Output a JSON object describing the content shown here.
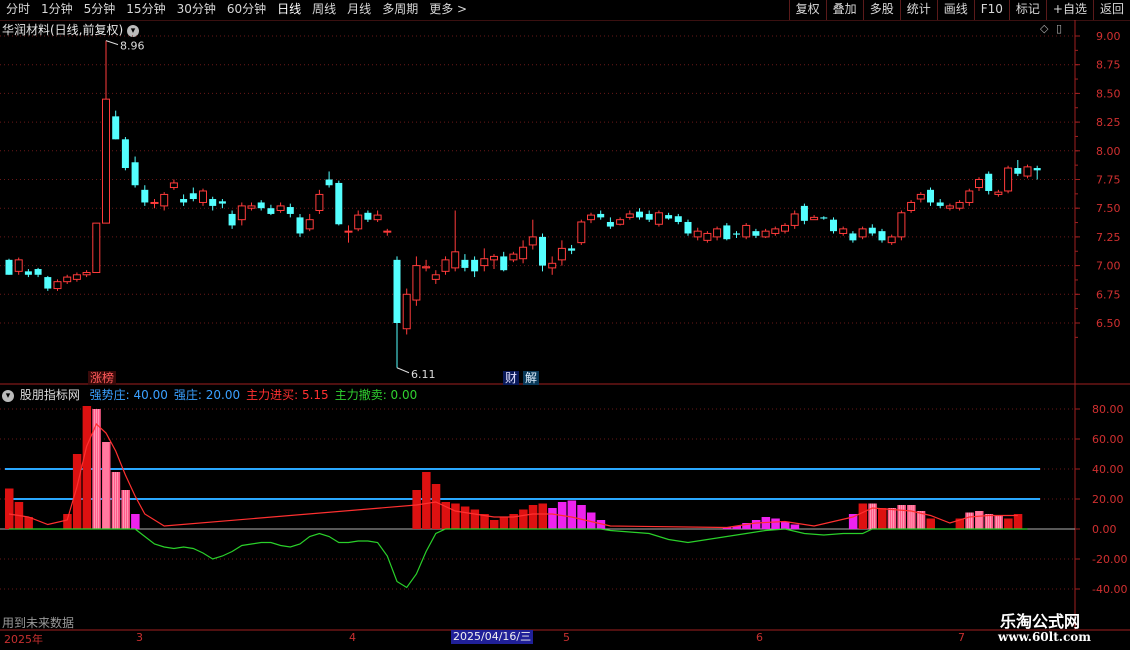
{
  "toolbar": {
    "tabs": [
      "分时",
      "1分钟",
      "5分钟",
      "15分钟",
      "30分钟",
      "60分钟",
      "日线",
      "周线",
      "月线",
      "多周期",
      "更多 >"
    ],
    "active_tab": "日线",
    "right_buttons": [
      "复权",
      "叠加",
      "多股",
      "统计",
      "画线",
      "F10",
      "标记",
      "+自选",
      "返回"
    ]
  },
  "price_panel": {
    "title": "华润材料(日线,前复权)",
    "y_ticks": [
      "9.00",
      "8.75",
      "8.50",
      "8.25",
      "8.00",
      "7.75",
      "7.50",
      "7.25",
      "7.00",
      "6.75",
      "6.50"
    ],
    "high_marker": "8.96",
    "low_marker": "6.11",
    "badges": {
      "limit_up": "涨榜",
      "finance1": "财",
      "finance2": "解"
    }
  },
  "indicator": {
    "name": "股朋指标网",
    "items": [
      {
        "label": "强势庄: 40.00",
        "color": "#3aa0ff"
      },
      {
        "label": "强庄: 20.00",
        "color": "#3aa0ff"
      },
      {
        "label": "主力进买: 5.15",
        "color": "#ff3030"
      },
      {
        "label": "主力撤卖: 0.00",
        "color": "#30d030"
      }
    ],
    "y_ticks": [
      "80.00",
      "60.00",
      "40.00",
      "20.00",
      "0.00",
      "-20.00",
      "-40.00"
    ],
    "level_lines": [
      40,
      20
    ]
  },
  "footer": {
    "future_data": "用到未来数据",
    "axis_labels": [
      "2025年",
      "3",
      "4",
      "2025/04/16/三",
      "5",
      "6",
      "7"
    ],
    "watermark_1": "乐淘公式网",
    "watermark_2": "www.60lt.com"
  },
  "chart_data": {
    "type": "candlestick",
    "price_range": [
      6.0,
      9.1
    ],
    "candles": [
      [
        7.05,
        6.92,
        7.06,
        6.92
      ],
      [
        6.95,
        7.05,
        7.07,
        6.92
      ],
      [
        6.95,
        6.92,
        6.97,
        6.9
      ],
      [
        6.97,
        6.92,
        6.98,
        6.9
      ],
      [
        6.9,
        6.8,
        6.91,
        6.78
      ],
      [
        6.8,
        6.86,
        6.88,
        6.78
      ],
      [
        6.86,
        6.9,
        6.92,
        6.84
      ],
      [
        6.88,
        6.92,
        6.94,
        6.86
      ],
      [
        6.92,
        6.94,
        6.96,
        6.9
      ],
      [
        6.94,
        7.37,
        7.37,
        6.94
      ],
      [
        7.37,
        8.45,
        8.96,
        7.37
      ],
      [
        8.3,
        8.1,
        8.35,
        8.1
      ],
      [
        8.1,
        7.85,
        8.12,
        7.83
      ],
      [
        7.9,
        7.7,
        7.95,
        7.68
      ],
      [
        7.66,
        7.55,
        7.7,
        7.52
      ],
      [
        7.55,
        7.55,
        7.58,
        7.5
      ],
      [
        7.52,
        7.62,
        7.64,
        7.48
      ],
      [
        7.68,
        7.72,
        7.75,
        7.66
      ],
      [
        7.58,
        7.55,
        7.62,
        7.52
      ],
      [
        7.63,
        7.58,
        7.68,
        7.56
      ],
      [
        7.55,
        7.65,
        7.67,
        7.52
      ],
      [
        7.58,
        7.52,
        7.6,
        7.48
      ],
      [
        7.56,
        7.54,
        7.58,
        7.5
      ],
      [
        7.45,
        7.35,
        7.48,
        7.32
      ],
      [
        7.4,
        7.52,
        7.55,
        7.35
      ],
      [
        7.5,
        7.52,
        7.55,
        7.48
      ],
      [
        7.55,
        7.5,
        7.57,
        7.48
      ],
      [
        7.5,
        7.45,
        7.53,
        7.44
      ],
      [
        7.48,
        7.52,
        7.55,
        7.46
      ],
      [
        7.51,
        7.45,
        7.54,
        7.42
      ],
      [
        7.42,
        7.28,
        7.45,
        7.25
      ],
      [
        7.32,
        7.4,
        7.45,
        7.3
      ],
      [
        7.48,
        7.62,
        7.66,
        7.45
      ],
      [
        7.75,
        7.7,
        7.82,
        7.68
      ],
      [
        7.72,
        7.36,
        7.74,
        7.35
      ],
      [
        7.3,
        7.3,
        7.35,
        7.2
      ],
      [
        7.32,
        7.44,
        7.48,
        7.3
      ],
      [
        7.46,
        7.4,
        7.48,
        7.38
      ],
      [
        7.4,
        7.44,
        7.48,
        7.38
      ],
      [
        7.3,
        7.3,
        7.32,
        7.26
      ],
      [
        7.05,
        6.5,
        7.08,
        6.11
      ],
      [
        6.45,
        6.75,
        6.8,
        6.4
      ],
      [
        6.7,
        7.0,
        7.08,
        6.65
      ],
      [
        6.98,
        6.99,
        7.05,
        6.95
      ],
      [
        6.88,
        6.92,
        6.96,
        6.84
      ],
      [
        6.95,
        7.05,
        7.08,
        6.92
      ],
      [
        6.98,
        7.12,
        7.48,
        6.95
      ],
      [
        7.05,
        6.98,
        7.1,
        6.95
      ],
      [
        7.05,
        6.95,
        7.08,
        6.9
      ],
      [
        7.0,
        7.06,
        7.15,
        6.95
      ],
      [
        7.05,
        7.08,
        7.1,
        6.97
      ],
      [
        7.08,
        6.96,
        7.12,
        6.95
      ],
      [
        7.05,
        7.1,
        7.12,
        7.03
      ],
      [
        7.06,
        7.16,
        7.22,
        7.02
      ],
      [
        7.18,
        7.25,
        7.4,
        7.14
      ],
      [
        7.25,
        7.0,
        7.28,
        6.95
      ],
      [
        6.98,
        7.02,
        7.08,
        6.92
      ],
      [
        7.05,
        7.15,
        7.22,
        7.0
      ],
      [
        7.15,
        7.13,
        7.18,
        7.1
      ],
      [
        7.2,
        7.38,
        7.4,
        7.18
      ],
      [
        7.4,
        7.44,
        7.46,
        7.37
      ],
      [
        7.45,
        7.42,
        7.48,
        7.4
      ],
      [
        7.38,
        7.34,
        7.42,
        7.32
      ],
      [
        7.36,
        7.4,
        7.42,
        7.35
      ],
      [
        7.42,
        7.45,
        7.48,
        7.4
      ],
      [
        7.47,
        7.42,
        7.5,
        7.4
      ],
      [
        7.45,
        7.4,
        7.48,
        7.38
      ],
      [
        7.36,
        7.46,
        7.48,
        7.34
      ],
      [
        7.44,
        7.41,
        7.46,
        7.4
      ],
      [
        7.43,
        7.38,
        7.45,
        7.36
      ],
      [
        7.38,
        7.28,
        7.4,
        7.26
      ],
      [
        7.25,
        7.3,
        7.33,
        7.22
      ],
      [
        7.22,
        7.28,
        7.3,
        7.2
      ],
      [
        7.25,
        7.32,
        7.34,
        7.22
      ],
      [
        7.35,
        7.23,
        7.37,
        7.22
      ],
      [
        7.28,
        7.27,
        7.3,
        7.24
      ],
      [
        7.25,
        7.35,
        7.37,
        7.23
      ],
      [
        7.3,
        7.26,
        7.32,
        7.24
      ],
      [
        7.25,
        7.3,
        7.32,
        7.24
      ],
      [
        7.28,
        7.32,
        7.34,
        7.26
      ],
      [
        7.3,
        7.35,
        7.37,
        7.28
      ],
      [
        7.35,
        7.45,
        7.48,
        7.32
      ],
      [
        7.52,
        7.39,
        7.54,
        7.36
      ],
      [
        7.4,
        7.42,
        7.44,
        7.4
      ],
      [
        7.42,
        7.41,
        7.43,
        7.4
      ],
      [
        7.4,
        7.3,
        7.42,
        7.28
      ],
      [
        7.28,
        7.32,
        7.34,
        7.26
      ],
      [
        7.28,
        7.22,
        7.3,
        7.2
      ],
      [
        7.25,
        7.32,
        7.34,
        7.23
      ],
      [
        7.33,
        7.28,
        7.36,
        7.26
      ],
      [
        7.3,
        7.22,
        7.32,
        7.2
      ],
      [
        7.2,
        7.25,
        7.27,
        7.18
      ],
      [
        7.25,
        7.46,
        7.48,
        7.22
      ],
      [
        7.48,
        7.55,
        7.57,
        7.46
      ],
      [
        7.58,
        7.62,
        7.64,
        7.55
      ],
      [
        7.66,
        7.55,
        7.68,
        7.52
      ],
      [
        7.55,
        7.52,
        7.58,
        7.5
      ],
      [
        7.5,
        7.52,
        7.54,
        7.48
      ],
      [
        7.5,
        7.55,
        7.57,
        7.48
      ],
      [
        7.55,
        7.65,
        7.67,
        7.52
      ],
      [
        7.68,
        7.75,
        7.77,
        7.65
      ],
      [
        7.8,
        7.65,
        7.82,
        7.62
      ],
      [
        7.62,
        7.64,
        7.66,
        7.6
      ],
      [
        7.65,
        7.85,
        7.87,
        7.63
      ],
      [
        7.85,
        7.8,
        7.92,
        7.78
      ],
      [
        7.78,
        7.86,
        7.88,
        7.76
      ],
      [
        7.85,
        7.83,
        7.87,
        7.75
      ]
    ],
    "indicator_bars": [
      {
        "i": 0,
        "v": 27,
        "c": "red"
      },
      {
        "i": 1,
        "v": 18,
        "c": "red"
      },
      {
        "i": 2,
        "v": 8,
        "c": "red"
      },
      {
        "i": 6,
        "v": 10,
        "c": "red"
      },
      {
        "i": 7,
        "v": 50,
        "c": "red"
      },
      {
        "i": 8,
        "v": 82,
        "c": "red"
      },
      {
        "i": 9,
        "v": 80,
        "c": "pink"
      },
      {
        "i": 10,
        "v": 58,
        "c": "pink"
      },
      {
        "i": 11,
        "v": 38,
        "c": "pink"
      },
      {
        "i": 12,
        "v": 26,
        "c": "pink"
      },
      {
        "i": 13,
        "v": 10,
        "c": "magenta"
      },
      {
        "i": 42,
        "v": 26,
        "c": "red"
      },
      {
        "i": 43,
        "v": 38,
        "c": "red"
      },
      {
        "i": 44,
        "v": 30,
        "c": "red"
      },
      {
        "i": 45,
        "v": 18,
        "c": "red"
      },
      {
        "i": 46,
        "v": 17,
        "c": "red"
      },
      {
        "i": 47,
        "v": 15,
        "c": "red"
      },
      {
        "i": 48,
        "v": 13,
        "c": "red"
      },
      {
        "i": 49,
        "v": 10,
        "c": "red"
      },
      {
        "i": 50,
        "v": 6,
        "c": "red"
      },
      {
        "i": 51,
        "v": 8,
        "c": "red"
      },
      {
        "i": 52,
        "v": 10,
        "c": "red"
      },
      {
        "i": 53,
        "v": 13,
        "c": "red"
      },
      {
        "i": 54,
        "v": 16,
        "c": "red"
      },
      {
        "i": 55,
        "v": 17,
        "c": "red"
      },
      {
        "i": 56,
        "v": 14,
        "c": "magenta"
      },
      {
        "i": 57,
        "v": 18,
        "c": "magenta"
      },
      {
        "i": 58,
        "v": 19,
        "c": "magenta"
      },
      {
        "i": 59,
        "v": 16,
        "c": "magenta"
      },
      {
        "i": 60,
        "v": 11,
        "c": "magenta"
      },
      {
        "i": 61,
        "v": 6,
        "c": "magenta"
      },
      {
        "i": 74,
        "v": 1,
        "c": "magenta"
      },
      {
        "i": 75,
        "v": 2,
        "c": "magenta"
      },
      {
        "i": 76,
        "v": 4,
        "c": "magenta"
      },
      {
        "i": 77,
        "v": 6,
        "c": "magenta"
      },
      {
        "i": 78,
        "v": 8,
        "c": "magenta"
      },
      {
        "i": 79,
        "v": 7,
        "c": "magenta"
      },
      {
        "i": 80,
        "v": 5,
        "c": "magenta"
      },
      {
        "i": 81,
        "v": 3,
        "c": "magenta"
      },
      {
        "i": 87,
        "v": 10,
        "c": "magenta"
      },
      {
        "i": 88,
        "v": 17,
        "c": "red"
      },
      {
        "i": 89,
        "v": 17,
        "c": "pink"
      },
      {
        "i": 90,
        "v": 14,
        "c": "red"
      },
      {
        "i": 91,
        "v": 14,
        "c": "pink"
      },
      {
        "i": 92,
        "v": 16,
        "c": "pink"
      },
      {
        "i": 93,
        "v": 16,
        "c": "pink"
      },
      {
        "i": 94,
        "v": 12,
        "c": "pink"
      },
      {
        "i": 95,
        "v": 7,
        "c": "red"
      },
      {
        "i": 98,
        "v": 7,
        "c": "red"
      },
      {
        "i": 99,
        "v": 11,
        "c": "pink"
      },
      {
        "i": 100,
        "v": 12,
        "c": "pink"
      },
      {
        "i": 101,
        "v": 10,
        "c": "pink"
      },
      {
        "i": 102,
        "v": 9,
        "c": "pink"
      },
      {
        "i": 103,
        "v": 7,
        "c": "red"
      },
      {
        "i": 104,
        "v": 10,
        "c": "red"
      }
    ],
    "red_line": [
      [
        0,
        10
      ],
      [
        2,
        8
      ],
      [
        4,
        3
      ],
      [
        6,
        6
      ],
      [
        7,
        28
      ],
      [
        8,
        55
      ],
      [
        9,
        70
      ],
      [
        10,
        64
      ],
      [
        11,
        52
      ],
      [
        12,
        36
      ],
      [
        13,
        22
      ],
      [
        14,
        10
      ],
      [
        16,
        2
      ],
      [
        42,
        16
      ],
      [
        44,
        18
      ],
      [
        46,
        12
      ],
      [
        48,
        10
      ],
      [
        50,
        8
      ],
      [
        52,
        8
      ],
      [
        54,
        10
      ],
      [
        56,
        10
      ],
      [
        58,
        8
      ],
      [
        60,
        5
      ],
      [
        62,
        2
      ],
      [
        74,
        1
      ],
      [
        77,
        4
      ],
      [
        80,
        5
      ],
      [
        83,
        2
      ],
      [
        87,
        8
      ],
      [
        89,
        14
      ],
      [
        91,
        13
      ],
      [
        93,
        12
      ],
      [
        95,
        9
      ],
      [
        97,
        4
      ],
      [
        99,
        8
      ],
      [
        101,
        9
      ],
      [
        104,
        9
      ]
    ],
    "green_line": [
      [
        0,
        0
      ],
      [
        13,
        0
      ],
      [
        14,
        -5
      ],
      [
        15,
        -10
      ],
      [
        16,
        -12
      ],
      [
        17,
        -13
      ],
      [
        18,
        -12
      ],
      [
        19,
        -13
      ],
      [
        20,
        -16
      ],
      [
        21,
        -20
      ],
      [
        22,
        -18
      ],
      [
        23,
        -15
      ],
      [
        24,
        -11
      ],
      [
        25,
        -10
      ],
      [
        26,
        -9
      ],
      [
        27,
        -9
      ],
      [
        28,
        -11
      ],
      [
        29,
        -12
      ],
      [
        30,
        -10
      ],
      [
        31,
        -5
      ],
      [
        32,
        -3
      ],
      [
        33,
        -5
      ],
      [
        34,
        -9
      ],
      [
        35,
        -9
      ],
      [
        36,
        -8
      ],
      [
        37,
        -8
      ],
      [
        38,
        -9
      ],
      [
        39,
        -18
      ],
      [
        40,
        -35
      ],
      [
        41,
        -39
      ],
      [
        42,
        -30
      ],
      [
        43,
        -15
      ],
      [
        44,
        -3
      ],
      [
        45,
        0
      ],
      [
        61,
        0
      ],
      [
        62,
        -1
      ],
      [
        64,
        -2
      ],
      [
        66,
        -3
      ],
      [
        68,
        -7
      ],
      [
        70,
        -9
      ],
      [
        72,
        -7
      ],
      [
        74,
        -5
      ],
      [
        76,
        -3
      ],
      [
        78,
        -1
      ],
      [
        80,
        0
      ],
      [
        82,
        -3
      ],
      [
        84,
        -4
      ],
      [
        86,
        -3
      ],
      [
        88,
        -3
      ],
      [
        89,
        0
      ],
      [
        105,
        0
      ]
    ]
  }
}
